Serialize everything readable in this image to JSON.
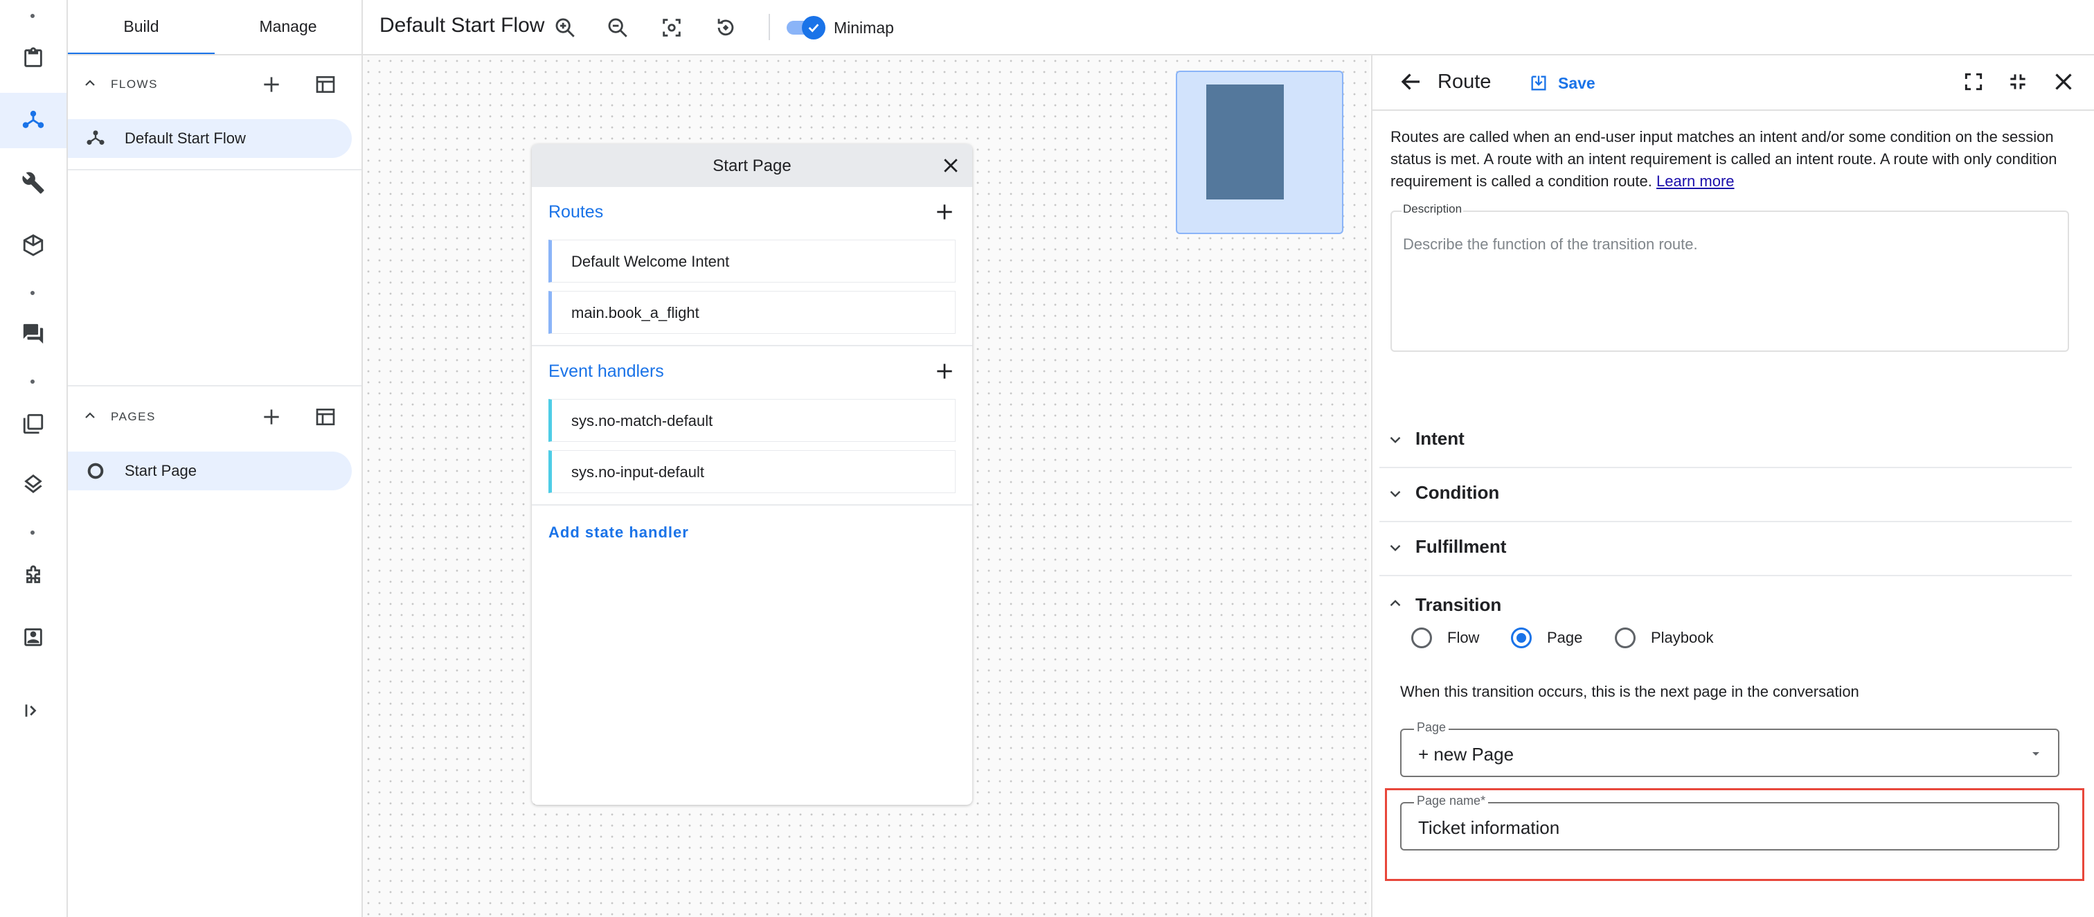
{
  "rail": {
    "icons": [
      "clipboard-icon",
      "flow-icon",
      "wrench-icon",
      "cube-icon",
      "chat-icon",
      "library-icon",
      "layers-icon",
      "puzzle-icon",
      "contact-icon",
      "expand-icon"
    ]
  },
  "nav": {
    "tabs": [
      {
        "label": "Build"
      },
      {
        "label": "Manage"
      }
    ],
    "flows": {
      "header": "FLOWS",
      "items": [
        {
          "label": "Default Start Flow"
        }
      ]
    },
    "pages": {
      "header": "PAGES",
      "items": [
        {
          "label": "Start Page"
        }
      ]
    }
  },
  "toolbar": {
    "title": "Default Start Flow",
    "minimap_label": "Minimap",
    "minimap_enabled": true
  },
  "card": {
    "title": "Start Page",
    "routes_label": "Routes",
    "routes": [
      {
        "label": "Default Welcome Intent"
      },
      {
        "label": "main.book_a_flight"
      }
    ],
    "event_handlers_label": "Event handlers",
    "event_handlers": [
      {
        "label": "sys.no-match-default"
      },
      {
        "label": "sys.no-input-default"
      }
    ],
    "add_state_handler": "Add state handler"
  },
  "route_panel": {
    "title": "Route",
    "save_label": "Save",
    "description_text": "Routes are called when an end-user input matches an intent and/or some condition on the session status is met. A route with an intent requirement is called an intent route. A route with only condition requirement is called a condition route.",
    "learn_more": "Learn more",
    "description_field": {
      "label": "Description",
      "placeholder": "Describe the function of the transition route."
    },
    "sections": {
      "intent": "Intent",
      "condition": "Condition",
      "fulfillment": "Fulfillment",
      "transition": "Transition"
    },
    "transition": {
      "options": [
        {
          "label": "Flow"
        },
        {
          "label": "Page"
        },
        {
          "label": "Playbook"
        }
      ],
      "selected": "Page",
      "hint": "When this transition occurs, this is the next page in the conversation",
      "page_select": {
        "label": "Page",
        "value": "+ new Page"
      },
      "page_name": {
        "label": "Page name*",
        "value": "Ticket information"
      }
    }
  },
  "colors": {
    "accent": "#1a73e8",
    "highlight": "#e8473b",
    "minimap": "#d2e3fc"
  }
}
